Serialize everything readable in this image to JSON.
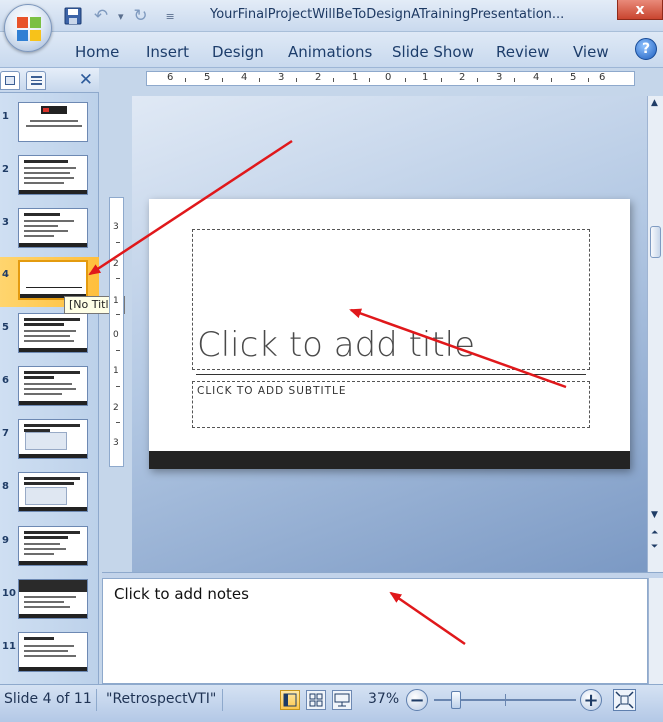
{
  "app": {
    "window_title": "YourFinalProjectWillBeToDesignATrainingPresentation...",
    "close_label": "x",
    "help_label": "?"
  },
  "ribbon": {
    "tabs": [
      "Home",
      "Insert",
      "Design",
      "Animations",
      "Slide Show",
      "Review",
      "View"
    ]
  },
  "panel": {
    "close_label": "✕",
    "slides": [
      {
        "number": "1",
        "layout": "title-logo"
      },
      {
        "number": "2",
        "layout": "bullets"
      },
      {
        "number": "3",
        "layout": "bullets"
      },
      {
        "number": "4",
        "layout": "blank-title",
        "selected": true
      },
      {
        "number": "5",
        "layout": "bullets"
      },
      {
        "number": "6",
        "layout": "bullets"
      },
      {
        "number": "7",
        "layout": "screenshot"
      },
      {
        "number": "8",
        "layout": "screenshot"
      },
      {
        "number": "9",
        "layout": "bullets"
      },
      {
        "number": "10",
        "layout": "dark-header"
      },
      {
        "number": "11",
        "layout": "bullets"
      }
    ],
    "tooltip": "[No Title]"
  },
  "ruler": {
    "h_labels": [
      "6",
      "5",
      "4",
      "3",
      "2",
      "1",
      "0",
      "1",
      "2",
      "3",
      "4",
      "5",
      "6"
    ],
    "v_labels": [
      "3",
      "2",
      "1",
      "0",
      "1",
      "2",
      "3"
    ]
  },
  "slide": {
    "title_placeholder": "Click to add title",
    "subtitle_placeholder": "CLICK TO ADD SUBTITLE"
  },
  "notes": {
    "placeholder": "Click to add notes"
  },
  "status": {
    "slide_info": "Slide 4 of 11",
    "theme": "\"RetrospectVTI\"",
    "zoom": "37%",
    "zoom_out": "−",
    "zoom_in": "+"
  },
  "colors": {
    "annotation_arrow": "#e0181b",
    "selected_slide": "#ffc84d",
    "slide_footer": "#232323"
  }
}
